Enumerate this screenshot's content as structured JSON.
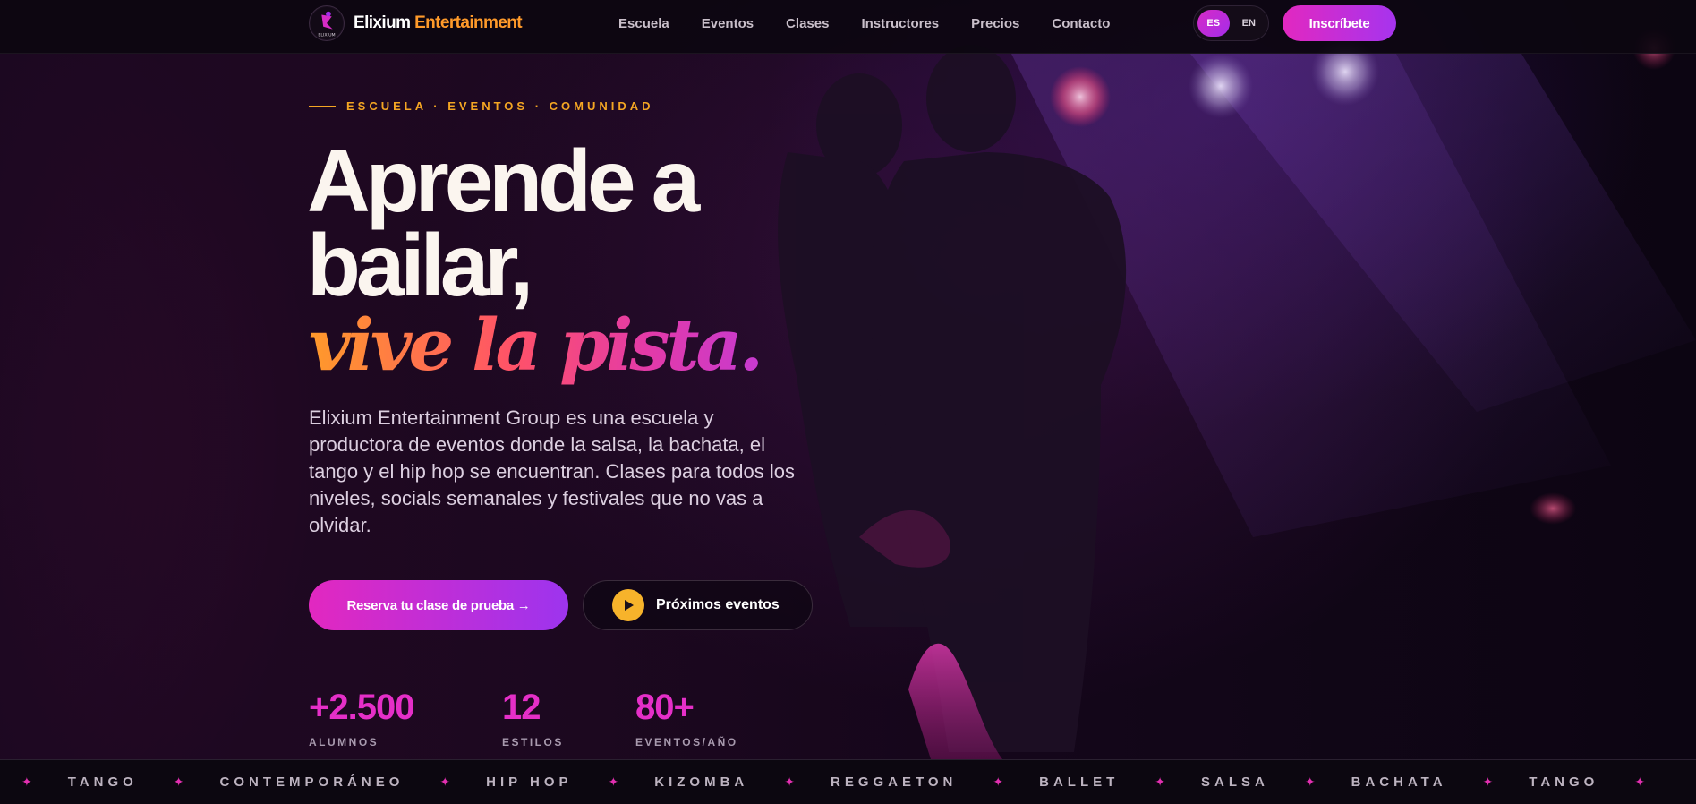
{
  "brand": {
    "name_white": "Elixium",
    "name_orange": "Entertainment",
    "mark_text": "ELIXIUM"
  },
  "nav": {
    "items": [
      {
        "label": "Escuela"
      },
      {
        "label": "Eventos"
      },
      {
        "label": "Clases"
      },
      {
        "label": "Instructores"
      },
      {
        "label": "Precios"
      },
      {
        "label": "Contacto"
      }
    ]
  },
  "language": {
    "options": [
      "ES",
      "EN"
    ],
    "selected": "ES"
  },
  "header": {
    "cta_label": "Inscríbete"
  },
  "hero": {
    "eyebrow": "ESCUELA · EVENTOS · COMUNIDAD",
    "headline_line1": "Aprende a",
    "headline_line2": "bailar,",
    "headline_accent": "vive la pista.",
    "lead": "Elixium Entertainment Group es una escuela y productora de eventos donde la salsa, la bachata, el tango y el hip hop se encuentran. Clases para todos los niveles, socials semanales y festivales que no vas a olvidar.",
    "primary_cta": "Reserva tu clase de prueba →",
    "secondary_cta": "Próximos eventos",
    "stats": [
      {
        "value": "+2.500",
        "label": "ALUMNOS"
      },
      {
        "value": "12",
        "label": "ESTILOS"
      },
      {
        "value": "80+",
        "label": "EVENTOS/AÑO"
      }
    ]
  },
  "ticker": {
    "styles": [
      "TANGO",
      "CONTEMPORÁNEO",
      "HIP HOP",
      "KIZOMBA",
      "REGGAETON",
      "BALLET",
      "SALSA",
      "BACHATA",
      "TANGO"
    ]
  },
  "colors": {
    "accent_pink": "#e52fc8",
    "accent_purple": "#a634ee",
    "accent_orange": "#ff9a2a",
    "eyebrow_gold": "#f4a623",
    "play_yellow": "#f7b32b",
    "background": "#0b0512"
  },
  "icons": {
    "logo": "dancer-logo-icon",
    "play": "play-icon",
    "ticker_separator": "sparkle-icon"
  }
}
